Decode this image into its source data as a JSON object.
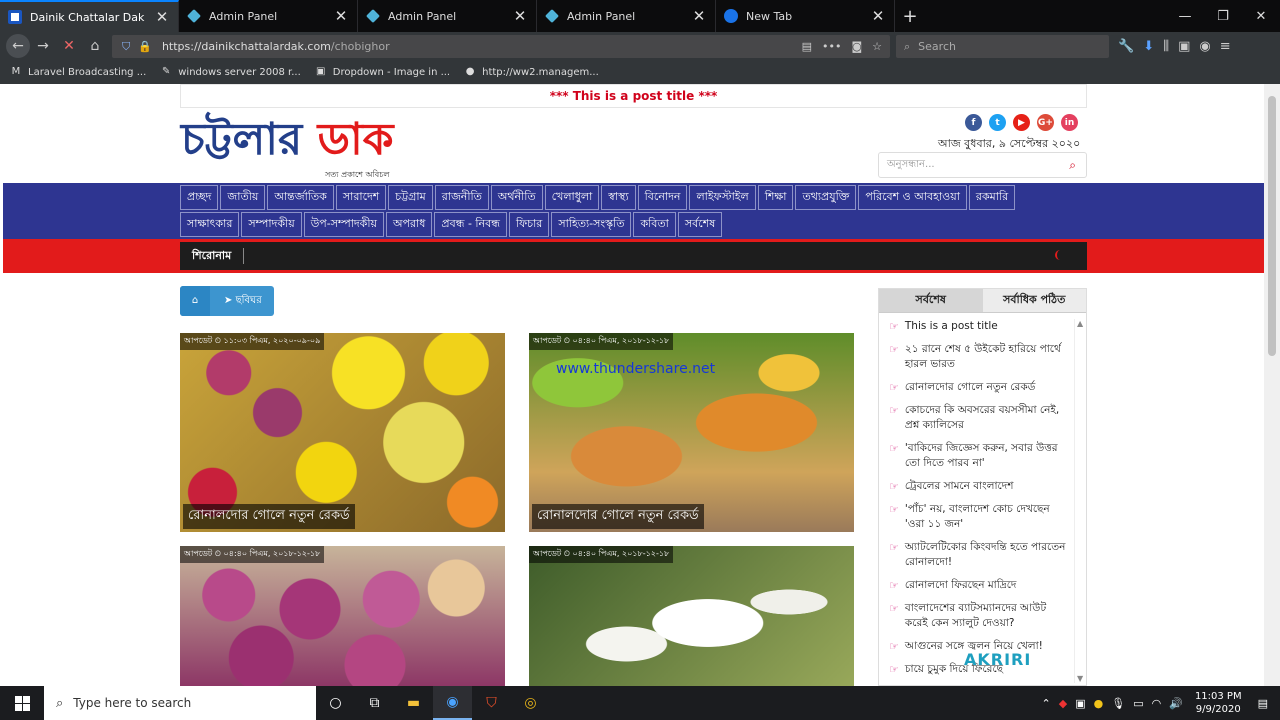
{
  "browser": {
    "tabs": [
      {
        "title": "Dainik Chattalar Dak",
        "active": true,
        "icon": "dd"
      },
      {
        "title": "Admin Panel",
        "active": false,
        "icon": "ap"
      },
      {
        "title": "Admin Panel",
        "active": false,
        "icon": "ap"
      },
      {
        "title": "Admin Panel",
        "active": false,
        "icon": "ap"
      },
      {
        "title": "New Tab",
        "active": false,
        "icon": "ff"
      }
    ],
    "url_host": "https://dainikchattalardak.com",
    "url_path": "/chobighor",
    "search_placeholder": "Search",
    "bookmarks": [
      {
        "icon": "M",
        "label": "Laravel Broadcasting ..."
      },
      {
        "icon": "✎",
        "label": "windows server 2008 r..."
      },
      {
        "icon": "▣",
        "label": "Dropdown - Image in ..."
      },
      {
        "icon": "●",
        "label": "http://ww2.managem..."
      }
    ]
  },
  "site": {
    "top_notice": "*** This is a post title ***",
    "logo_part1": "চট্টলার",
    "logo_part2": "ডাক",
    "tagline": "সত্য প্রকাশে অবিচল",
    "date_text": "আজ বুধবার, ৯ সেপ্টেম্বর ২০২০",
    "search_placeholder": "অনুসন্ধান...",
    "socials": [
      {
        "label": "f",
        "color": "#3b5998"
      },
      {
        "label": "t",
        "color": "#1da1f2"
      },
      {
        "label": "▶",
        "color": "#e62117"
      },
      {
        "label": "G+",
        "color": "#dd4b39"
      },
      {
        "label": "in",
        "color": "#e4405f"
      }
    ],
    "nav_row1": [
      "প্রচ্ছদ",
      "জাতীয়",
      "আন্তর্জাতিক",
      "সারাদেশ",
      "চট্টগ্রাম",
      "রাজনীতি",
      "অর্থনীতি",
      "খেলাধুলা",
      "স্বাস্থ্য",
      "বিনোদন",
      "লাইফস্টাইল",
      "শিক্ষা",
      "তথ্যপ্রযুক্তি",
      "পরিবেশ ও আবহাওয়া",
      "রকমারি"
    ],
    "nav_row2": [
      "সাক্ষাৎকার",
      "সম্পাদকীয়",
      "উপ-সম্পাদকীয়",
      "অপরাধ",
      "প্রবন্ধ - নিবন্ধ",
      "ফিচার",
      "সাহিত্য-সংস্কৃতি",
      "কবিতা",
      "সর্বশেষ"
    ],
    "ticker_label": "শিরোনাম",
    "breadcrumb": "ছবিঘর",
    "cards": [
      {
        "meta": "আপডেট ⏲ ১১:০৩ পিএম, ২০২০-০৯-০৯",
        "caption": "রোনালদোর গোলে নতুন রেকর্ড"
      },
      {
        "meta": "আপডেট ⏲ ০৪:৪০ পিএম, ২০১৮-১২-১৮",
        "caption": "রোনালদোর গোলে নতুন রেকর্ড",
        "watermark": "www.thundershare.net"
      },
      {
        "meta": "আপডেট ⏲ ০৪:৪০ পিএম, ২০১৮-১২-১৮",
        "caption": ""
      },
      {
        "meta": "আপডেট ⏲ ০৪:৪০ পিএম, ২০১৮-১২-১৮",
        "caption": ""
      }
    ],
    "sidebar_tabs": [
      "সর্বশেষ",
      "সর্বাধিক পঠিত"
    ],
    "sidebar_items": [
      "This is a post title",
      "২১ রানে শেষ ৫ উইকেট হারিয়ে পার্থে হারল ভারত",
      "রোনালদোর গোলে নতুন রেকর্ড",
      "কোচদের কি অবসরের বয়সসীমা নেই, প্রশ্ন ক্যালিসের",
      "'বাকিদের জিজ্ঞেস করুন, সবার উত্তর তো দিতে পারব না'",
      "ট্রেবলের সামনে বাংলাদেশ",
      "'পাঁচ' নয়, বাংলাদেশ কোচ দেখছেন 'ওরা ১১ জন'",
      "অ্যাটলেটিকোর কিংবদন্তি হতে পারতেন রোনালদো!",
      "রোনালদো ফিরছেন মাদ্রিদে",
      "বাংলাদেশের ব্যাটসম্যানদের আউট করেই কেন স্যালুট দেওয়া?",
      "আগুনের সঙ্গে জ্বলন নিয়ে খেলা!",
      "চায়ে চুমুক দিয়ে ফিরেছে"
    ],
    "watermark_brand": "AKRIRI"
  },
  "taskbar": {
    "search_placeholder": "Type here to search",
    "time": "11:03 PM",
    "date": "9/9/2020"
  },
  "colors": {
    "nav_blue": "#2e3591",
    "accent_red": "#e21b1b",
    "logo_blue": "#233f8a"
  }
}
